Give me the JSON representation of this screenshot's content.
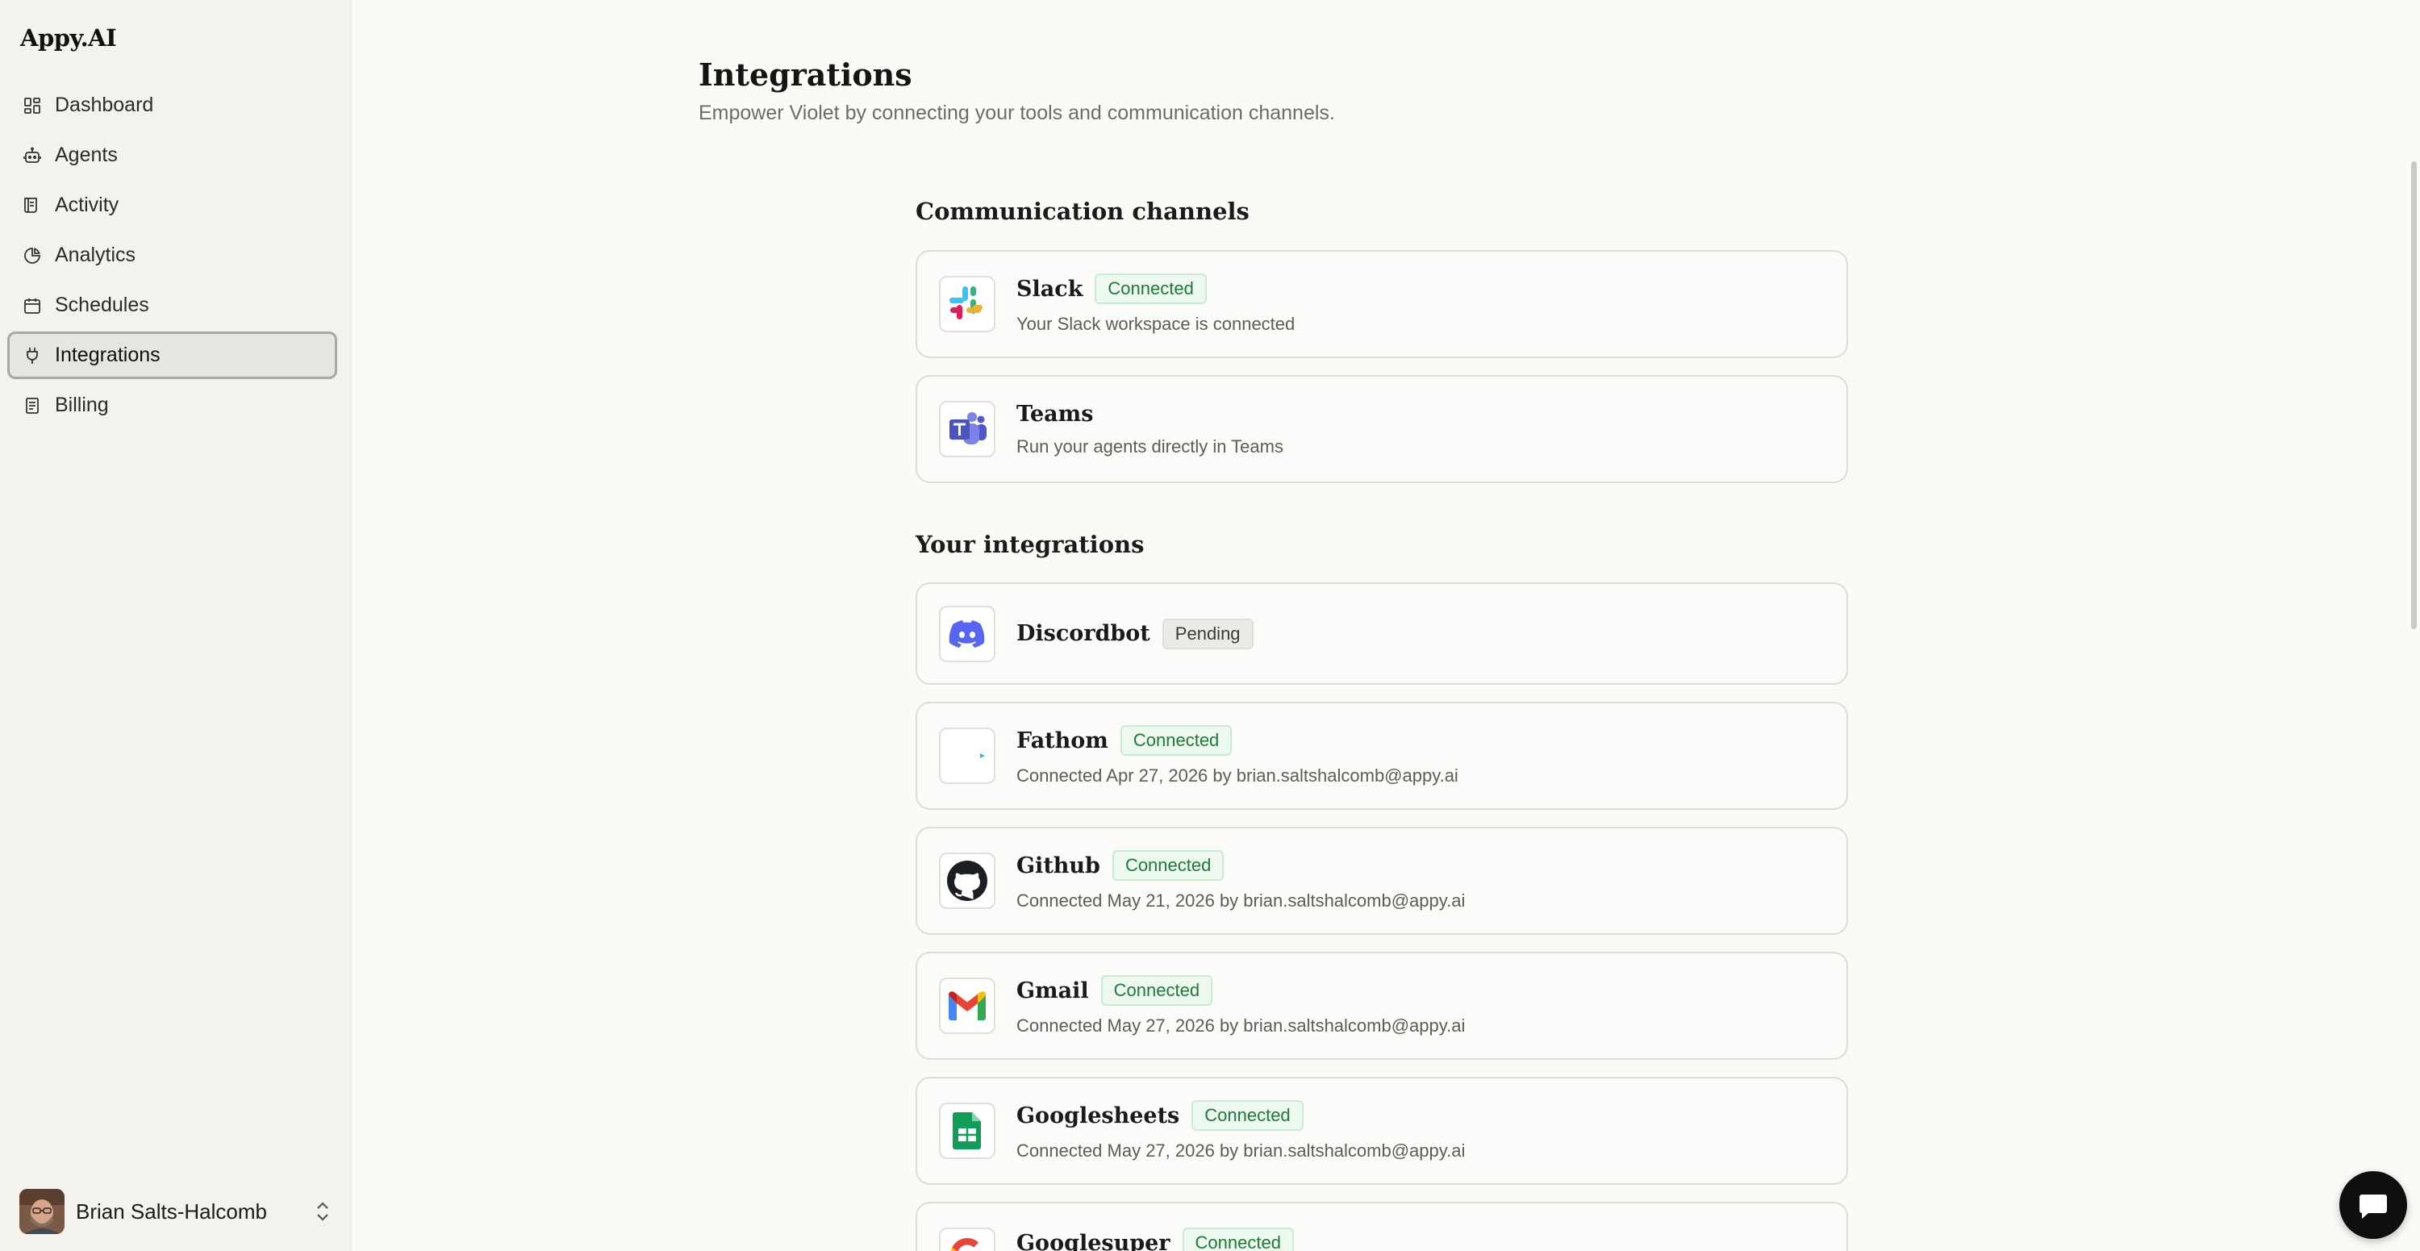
{
  "app": {
    "brand": "Appy.AI"
  },
  "sidebar": {
    "items": [
      {
        "label": "Dashboard",
        "icon": "dashboard-icon",
        "active": false
      },
      {
        "label": "Agents",
        "icon": "robot-icon",
        "active": false
      },
      {
        "label": "Activity",
        "icon": "activity-icon",
        "active": false
      },
      {
        "label": "Analytics",
        "icon": "pie-chart-icon",
        "active": false
      },
      {
        "label": "Schedules",
        "icon": "calendar-icon",
        "active": false
      },
      {
        "label": "Integrations",
        "icon": "plug-icon",
        "active": true
      },
      {
        "label": "Billing",
        "icon": "receipt-icon",
        "active": false
      }
    ],
    "user": {
      "name": "Brian Salts-Halcomb"
    }
  },
  "main": {
    "title": "Integrations",
    "subtitle": "Empower Violet by connecting your tools and communication channels.",
    "sections": {
      "communication": {
        "title": "Communication channels",
        "items": [
          {
            "name": "Slack",
            "status": "Connected",
            "description": "Your Slack workspace is connected",
            "icon": "slack-icon"
          },
          {
            "name": "Teams",
            "status": "",
            "description": "Run your agents directly in Teams",
            "icon": "teams-icon"
          }
        ]
      },
      "integrations": {
        "title": "Your integrations",
        "items": [
          {
            "name": "Discordbot",
            "status": "Pending",
            "description": "",
            "icon": "discord-icon"
          },
          {
            "name": "Fathom",
            "status": "Connected",
            "description": "Connected Apr 27, 2026 by brian.saltshalcomb@appy.ai",
            "icon": "fathom-icon"
          },
          {
            "name": "Github",
            "status": "Connected",
            "description": "Connected May 21, 2026 by brian.saltshalcomb@appy.ai",
            "icon": "github-icon"
          },
          {
            "name": "Gmail",
            "status": "Connected",
            "description": "Connected May 27, 2026 by brian.saltshalcomb@appy.ai",
            "icon": "gmail-icon"
          },
          {
            "name": "Googlesheets",
            "status": "Connected",
            "description": "Connected May 27, 2026 by brian.saltshalcomb@appy.ai",
            "icon": "google-sheets-icon"
          },
          {
            "name": "Googlesuper",
            "status": "Connected",
            "description": "",
            "icon": "google-icon"
          }
        ]
      }
    }
  },
  "colors": {
    "background": "#fafaf7",
    "sidebar": "#f3f2ed",
    "connected_text": "#1f7a3a",
    "connected_bg": "#edf8ef"
  }
}
